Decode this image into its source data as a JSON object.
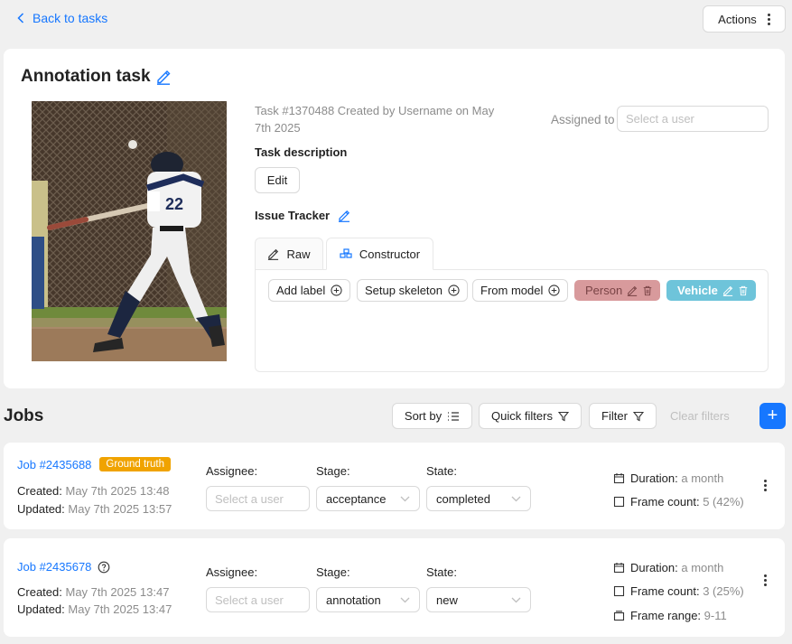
{
  "nav": {
    "back_label": "Back to tasks",
    "actions_label": "Actions"
  },
  "task": {
    "title": "Annotation task",
    "meta": "Task #1370488 Created by Username on May 7th 2025",
    "assigned_to_label": "Assigned to",
    "assigned_to_placeholder": "Select a user",
    "description_label": "Task description",
    "edit_label": "Edit",
    "issue_tracker_label": "Issue Tracker",
    "tabs": {
      "raw": "Raw",
      "constructor": "Constructor"
    },
    "constructor_buttons": {
      "add_label": "Add label",
      "setup_skeleton": "Setup skeleton",
      "from_model": "From model"
    },
    "labels": [
      {
        "name": "Person",
        "color": "#d89a9c"
      },
      {
        "name": "Vehicle",
        "color": "#6ec4da"
      }
    ],
    "preview": {
      "jersey_number": "22"
    }
  },
  "jobs_header": {
    "title": "Jobs",
    "sort_by": "Sort by",
    "quick_filters": "Quick filters",
    "filter": "Filter",
    "clear_filters": "Clear filters",
    "add": "+"
  },
  "jobs": [
    {
      "id": "Job #2435688",
      "badge": "Ground truth",
      "created_label": "Created:",
      "created": "May 7th 2025 13:48",
      "updated_label": "Updated:",
      "updated": "May 7th 2025 13:57",
      "assignee_label": "Assignee:",
      "assignee_placeholder": "Select a user",
      "stage_label": "Stage:",
      "stage": "acceptance",
      "state_label": "State:",
      "state": "completed",
      "duration_label": "Duration:",
      "duration": "a month",
      "frame_count_label": "Frame count:",
      "frame_count": "5 (42%)"
    },
    {
      "id": "Job #2435678",
      "created_label": "Created:",
      "created": "May 7th 2025 13:47",
      "updated_label": "Updated:",
      "updated": "May 7th 2025 13:47",
      "assignee_label": "Assignee:",
      "assignee_placeholder": "Select a user",
      "stage_label": "Stage:",
      "stage": "annotation",
      "state_label": "State:",
      "state": "new",
      "duration_label": "Duration:",
      "duration": "a month",
      "frame_count_label": "Frame count:",
      "frame_count": "3 (25%)",
      "frame_range_label": "Frame range:",
      "frame_range": "9-11"
    }
  ],
  "colors": {
    "accent": "#1677ff",
    "ground_truth": "#f0a300",
    "person": "#d89a9c",
    "vehicle": "#6ec4da"
  }
}
